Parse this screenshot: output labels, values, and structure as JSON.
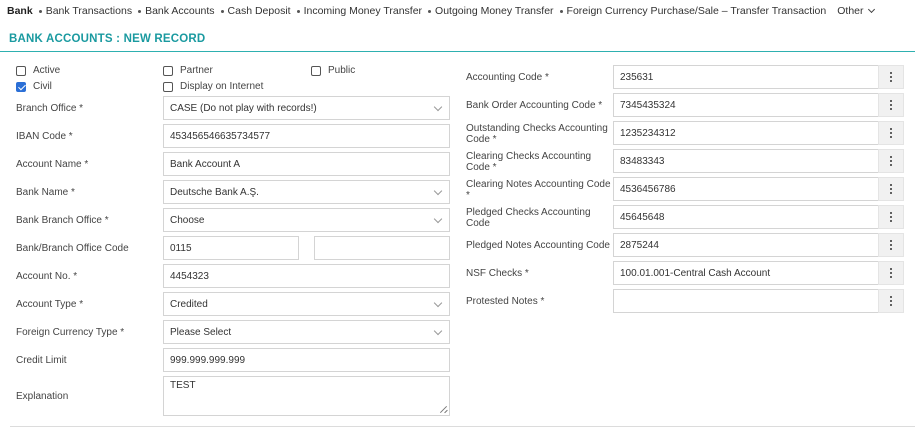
{
  "nav": {
    "items": [
      "Bank",
      "Bank Transactions",
      "Bank Accounts",
      "Cash Deposit",
      "Incoming Money Transfer",
      "Outgoing Money Transfer",
      "Foreign Currency Purchase/Sale – Transfer Transaction",
      "Other"
    ]
  },
  "page": {
    "title": "BANK ACCOUNTS : NEW RECORD"
  },
  "checkboxes": {
    "active": {
      "label": "Active",
      "checked": false
    },
    "partner": {
      "label": "Partner",
      "checked": false
    },
    "public": {
      "label": "Public",
      "checked": false
    },
    "civil": {
      "label": "Civil",
      "checked": true
    },
    "display_on_internet": {
      "label": "Display on Internet",
      "checked": false
    }
  },
  "left": {
    "branch_office": {
      "label": "Branch Office *",
      "value": "CASE (Do not play with records!)"
    },
    "iban": {
      "label": "IBAN Code *",
      "value": "453456546635734577"
    },
    "account_name": {
      "label": "Account Name *",
      "value": "Bank Account A"
    },
    "bank_name": {
      "label": "Bank Name *",
      "value": "Deutsche Bank A.Ş."
    },
    "bank_branch_office": {
      "label": "Bank Branch Office *",
      "value": "Choose"
    },
    "bank_branch_code": {
      "label": "Bank/Branch Office Code",
      "value": "0115",
      "value2": ""
    },
    "account_no": {
      "label": "Account No. *",
      "value": "4454323"
    },
    "account_type": {
      "label": "Account Type *",
      "value": "Credited"
    },
    "foreign_currency_type": {
      "label": "Foreign Currency Type *",
      "value": "Please Select"
    },
    "credit_limit": {
      "label": "Credit Limit",
      "value": "999.999.999.999"
    },
    "explanation": {
      "label": "Explanation",
      "value": "TEST"
    }
  },
  "right": {
    "accounting_code": {
      "label": "Accounting Code *",
      "value": "235631"
    },
    "bank_order_code": {
      "label": "Bank Order Accounting Code *",
      "value": "7345435324"
    },
    "outstanding_checks": {
      "label1": "Outstanding Checks Accounting",
      "label2": "Code *",
      "value": "1235234312"
    },
    "clearing_checks": {
      "label1": "Clearing Checks Accounting",
      "label2": "Code *",
      "value": "83483343"
    },
    "clearing_notes": {
      "label1": "Clearing Notes Accounting Code",
      "label2": "*",
      "value": "4536456786"
    },
    "pledged_checks": {
      "label1": "Pledged Checks Accounting",
      "label2": "Code",
      "value": "45645648"
    },
    "pledged_notes": {
      "label": "Pledged Notes Accounting Code",
      "value": "2875244"
    },
    "nsf_checks": {
      "label": "NSF Checks *",
      "value": "100.01.001-Central Cash Account"
    },
    "protested_notes": {
      "label": "Protested Notes *",
      "value": ""
    }
  },
  "colors": {
    "accent": "#1a9aa0",
    "accent_line": "#2eb0b0",
    "checkbox_checked": "#2b6fd6"
  }
}
